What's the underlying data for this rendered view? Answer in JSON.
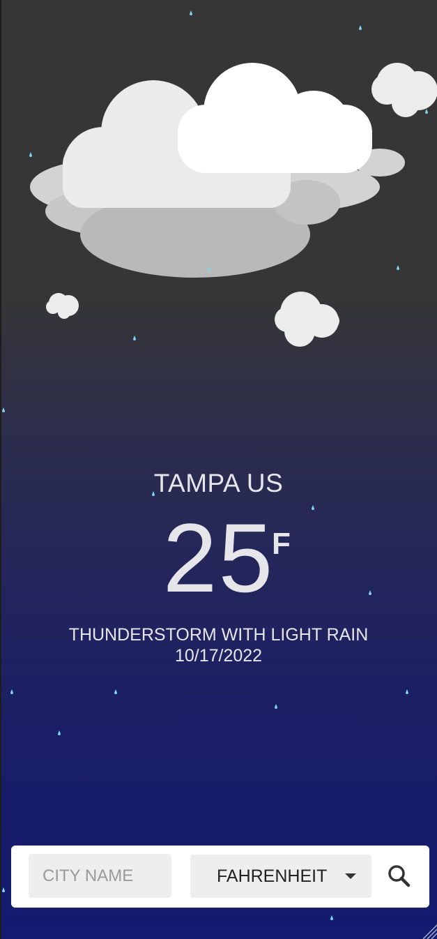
{
  "weather": {
    "location": "TAMPA US",
    "temperature": "25",
    "unit_symbol": "F",
    "description": "THUNDERSTORM WITH LIGHT RAIN",
    "date": "10/17/2022",
    "scene_icon": "clouds-with-rain-illustration"
  },
  "search": {
    "city_placeholder": "CITY NAME",
    "city_value": "",
    "unit_selected": "FAHRENHEIT",
    "unit_caret_icon": "caret-down-icon",
    "search_icon": "magnifier-icon"
  },
  "colors": {
    "background_top": "#363636",
    "background_bottom": "#141b70",
    "text": "#e6e6ea",
    "raindrop": "#7ed6f0",
    "cloud_light": "#ececec",
    "cloud_dark": "#b9b9b9",
    "panel": "#ffffff",
    "field": "#eeeeee"
  }
}
